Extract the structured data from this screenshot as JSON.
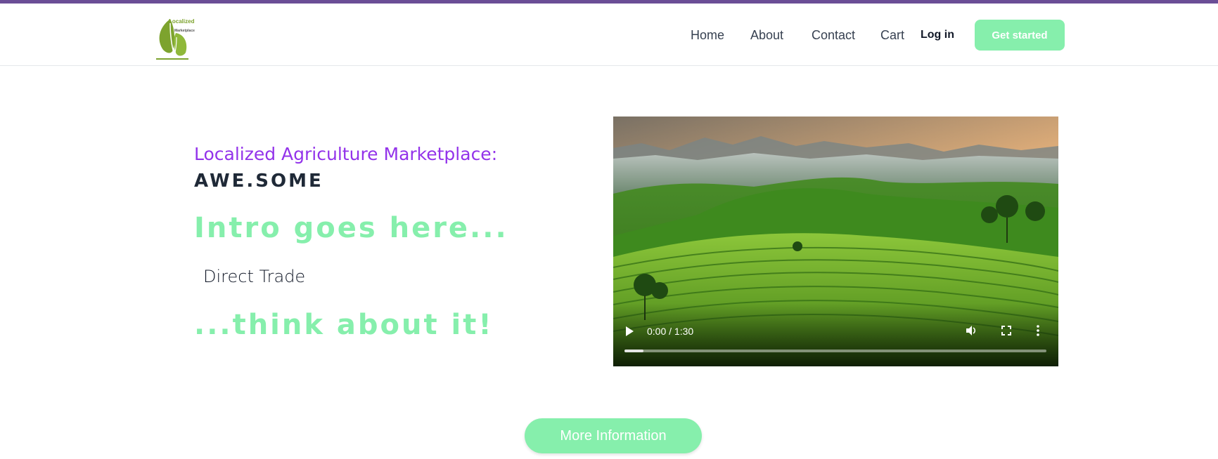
{
  "header": {
    "logo": {
      "line1": "Localized",
      "line2": "Marketplace",
      "icon": "leaf-icon"
    },
    "nav": [
      {
        "label": "Home"
      },
      {
        "label": "About"
      },
      {
        "label": "Contact"
      },
      {
        "label": "Cart"
      }
    ],
    "login_label": "Log in",
    "cta_label": "Get started"
  },
  "hero": {
    "subtitle": "Localized Agriculture Marketplace:",
    "brand": "AWE.SOME",
    "intro": "Intro goes here...",
    "typed_text": "Direct Trade",
    "outro": "...think about it!"
  },
  "video": {
    "time": "0:00 / 1:30",
    "progress": 0.045,
    "icons": [
      "play-icon",
      "volume-icon",
      "fullscreen-icon",
      "more-options-icon"
    ]
  },
  "more_button_label": "More Information",
  "colors": {
    "accent_green": "#86efac",
    "purple": "#9333ea",
    "topbar": "#6b4e96",
    "logo_green": "#7da32e"
  }
}
